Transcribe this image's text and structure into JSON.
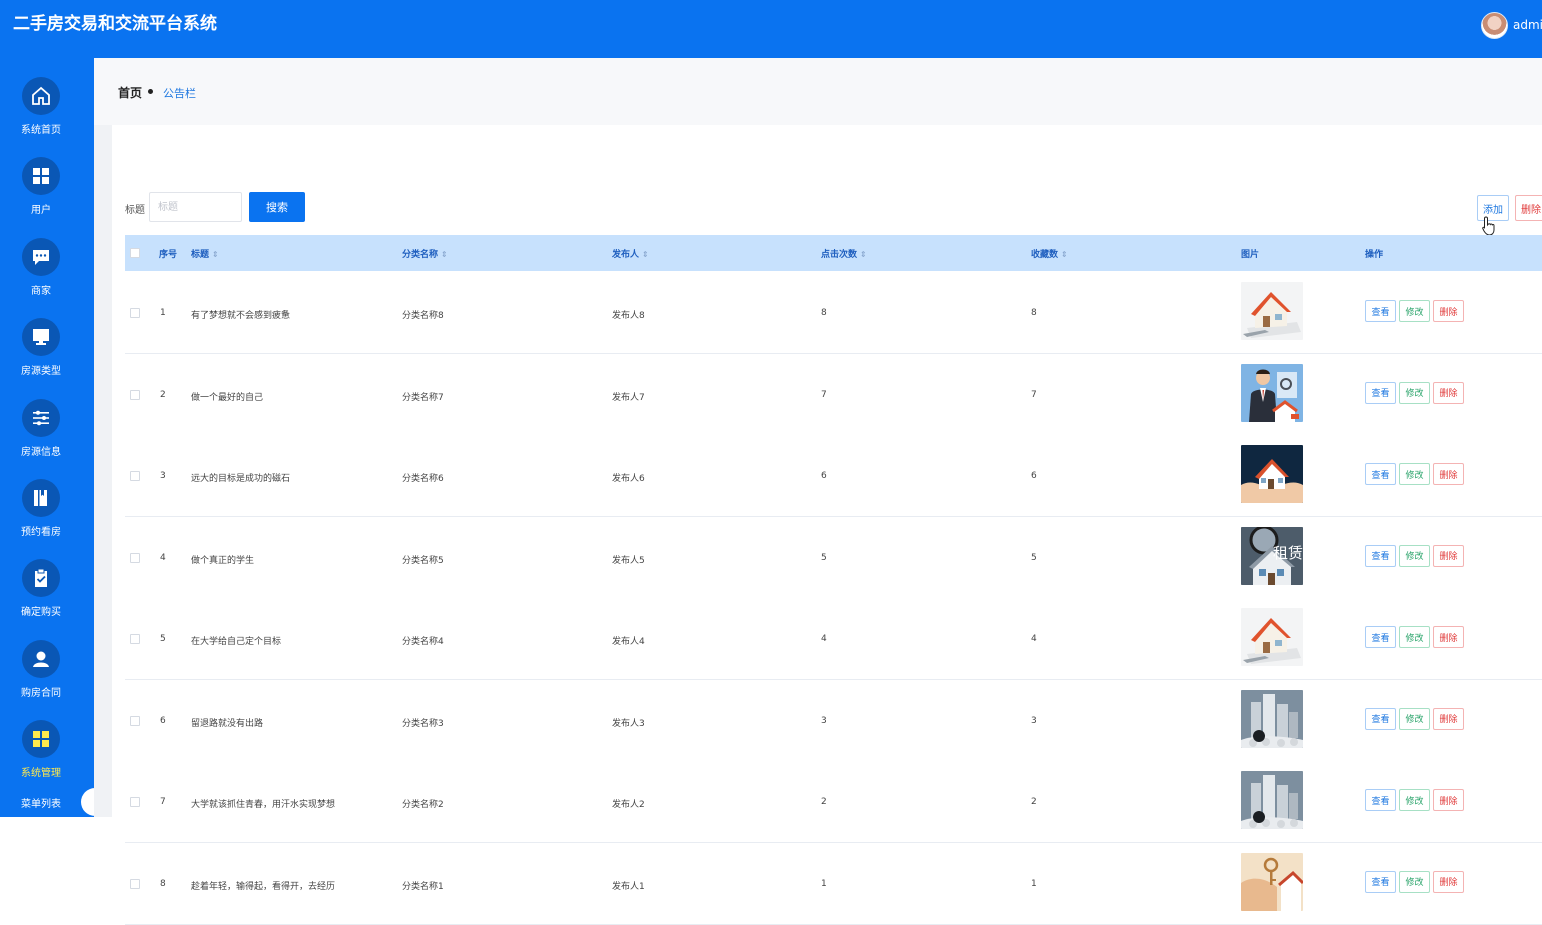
{
  "app": {
    "title": "二手房交易和交流平台系统",
    "user": "admin"
  },
  "sidebar": {
    "items": [
      {
        "label": "系统首页",
        "icon": "home-icon"
      },
      {
        "label": "用户",
        "icon": "grid-icon"
      },
      {
        "label": "商家",
        "icon": "chat-icon"
      },
      {
        "label": "房源类型",
        "icon": "monitor-icon"
      },
      {
        "label": "房源信息",
        "icon": "sliders-icon"
      },
      {
        "label": "预约看房",
        "icon": "book-icon"
      },
      {
        "label": "确定购买",
        "icon": "clipboard-check-icon"
      },
      {
        "label": "购房合同",
        "icon": "user-icon"
      },
      {
        "label": "系统管理",
        "icon": "grid-icon",
        "active": true
      }
    ],
    "sub_label": "菜单列表"
  },
  "breadcrumb": {
    "home": "首页",
    "current": "公告栏"
  },
  "search": {
    "label": "标题",
    "placeholder": "标题",
    "button": "搜索"
  },
  "toolbar": {
    "add": "添加",
    "delete": "删除"
  },
  "table": {
    "headers": {
      "index": "序号",
      "title": "标题",
      "category": "分类名称",
      "publisher": "发布人",
      "clicks": "点击次数",
      "favorites": "收藏数",
      "image": "图片",
      "actions": "操作"
    },
    "actions": {
      "view": "查看",
      "edit": "修改",
      "delete": "删除"
    },
    "rows": [
      {
        "index": "1",
        "title": "有了梦想就不会感到疲惫",
        "category": "分类名称8",
        "publisher": "发布人8",
        "clicks": "8",
        "favorites": "8",
        "image": "house-model"
      },
      {
        "index": "2",
        "title": "做一个最好的自己",
        "category": "分类名称7",
        "publisher": "发布人7",
        "clicks": "7",
        "favorites": "7",
        "image": "businessman"
      },
      {
        "index": "3",
        "title": "远大的目标是成功的磁石",
        "category": "分类名称6",
        "publisher": "发布人6",
        "clicks": "6",
        "favorites": "6",
        "image": "house-in-hands"
      },
      {
        "index": "4",
        "title": "做个真正的学生",
        "category": "分类名称5",
        "publisher": "发布人5",
        "clicks": "5",
        "favorites": "5",
        "image": "rent-magnifier",
        "image_text": "租赁"
      },
      {
        "index": "5",
        "title": "在大学给自己定个目标",
        "category": "分类名称4",
        "publisher": "发布人4",
        "clicks": "4",
        "favorites": "4",
        "image": "house-model"
      },
      {
        "index": "6",
        "title": "留退路就没有出路",
        "category": "分类名称3",
        "publisher": "发布人3",
        "clicks": "3",
        "favorites": "3",
        "image": "buildings-coins"
      },
      {
        "index": "7",
        "title": "大学就该抓住青春，用汗水实现梦想",
        "category": "分类名称2",
        "publisher": "发布人2",
        "clicks": "2",
        "favorites": "2",
        "image": "buildings-coins"
      },
      {
        "index": "8",
        "title": "趁着年轻，输得起，看得开，去经历",
        "category": "分类名称1",
        "publisher": "发布人1",
        "clicks": "1",
        "favorites": "1",
        "image": "keys"
      }
    ]
  }
}
